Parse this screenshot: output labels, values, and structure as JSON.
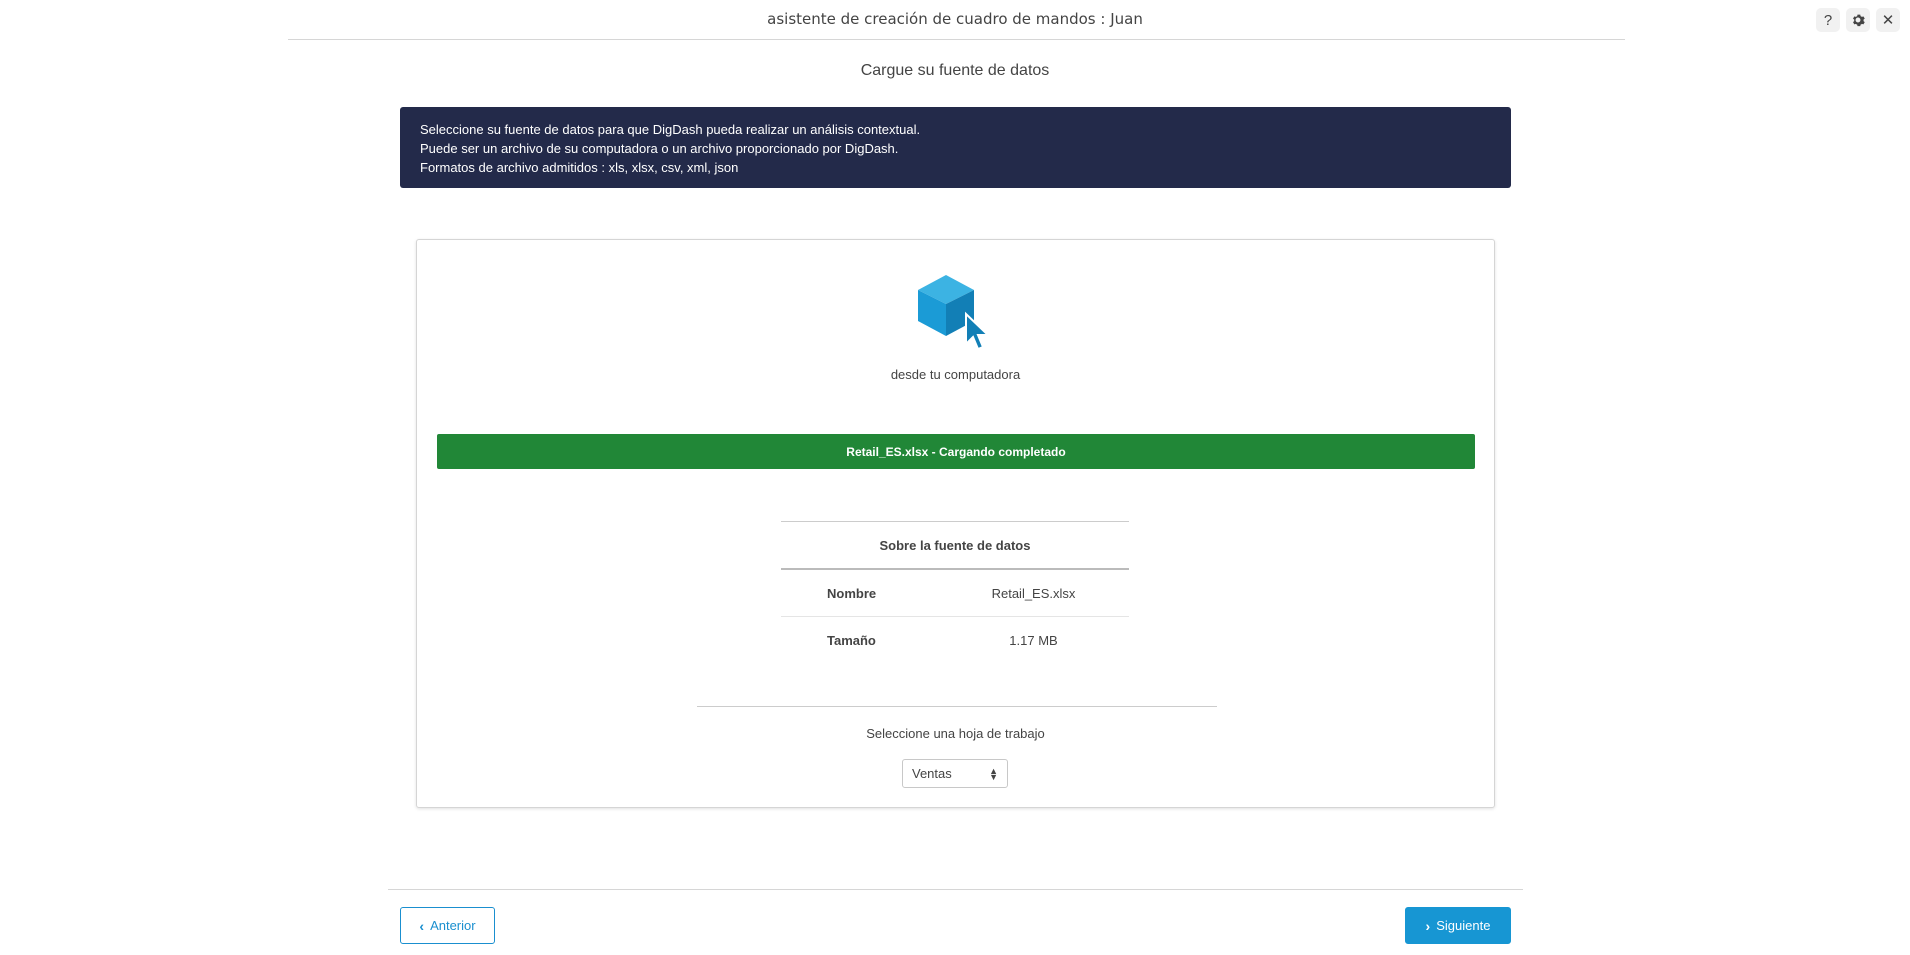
{
  "header": {
    "title": "asistente de creación de cuadro de mandos : Juan",
    "icons": [
      "help-icon",
      "gear-icon",
      "close-icon"
    ]
  },
  "step": {
    "title": "Cargue su fuente de datos"
  },
  "banner": {
    "lines": [
      "Seleccione su fuente de datos para que DigDash pueda realizar un análisis contextual.",
      "Puede ser un archivo de su computadora o un archivo proporcionado por DigDash.",
      "Formatos de archivo admitidos : xls, xlsx, csv, xml, json"
    ],
    "background": "#232a4a"
  },
  "source": {
    "label": "desde tu computadora",
    "icon": "cube-cursor-icon"
  },
  "upload": {
    "status_text": "Retail_ES.xlsx - Cargando completado",
    "color": "#218737"
  },
  "datasource_info": {
    "heading": "Sobre la fuente de datos",
    "rows": [
      {
        "key": "Nombre",
        "value": "Retail_ES.xlsx"
      },
      {
        "key": "Tamaño",
        "value": "1.17 MB"
      }
    ]
  },
  "sheet": {
    "label": "Seleccione una hoja de trabajo",
    "selected": "Ventas"
  },
  "footer": {
    "prev_label": "Anterior",
    "next_label": "Siguiente",
    "accent": "#1796d3"
  }
}
